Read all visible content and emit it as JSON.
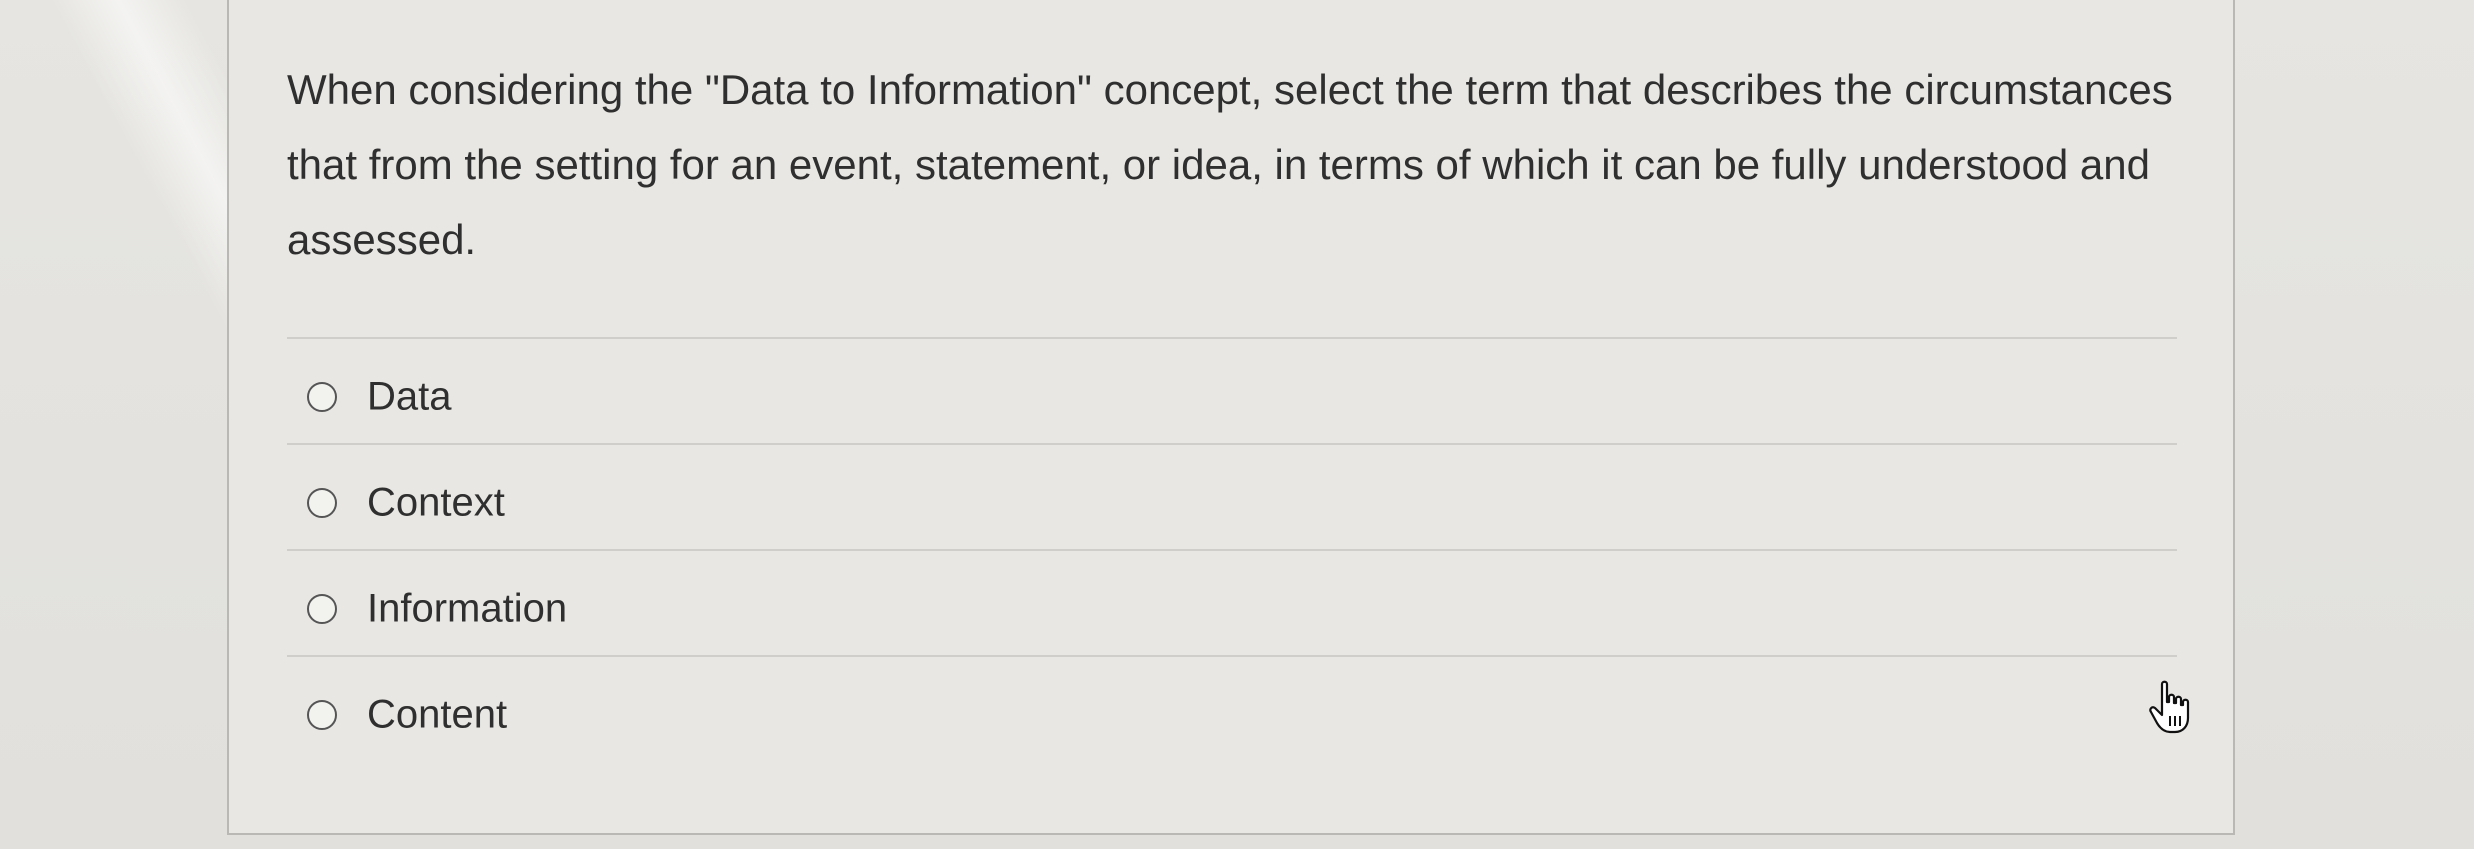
{
  "question": {
    "text": "When considering the \"Data to Information\" concept, select the term that describes the circumstances that from the setting for an event, statement, or idea, in terms of which it can be fully understood and assessed."
  },
  "answers": [
    {
      "label": "Data",
      "selected": false
    },
    {
      "label": "Context",
      "selected": false
    },
    {
      "label": "Information",
      "selected": false
    },
    {
      "label": "Content",
      "selected": false
    }
  ],
  "cursor": {
    "icon": "hand-pointer-icon"
  }
}
